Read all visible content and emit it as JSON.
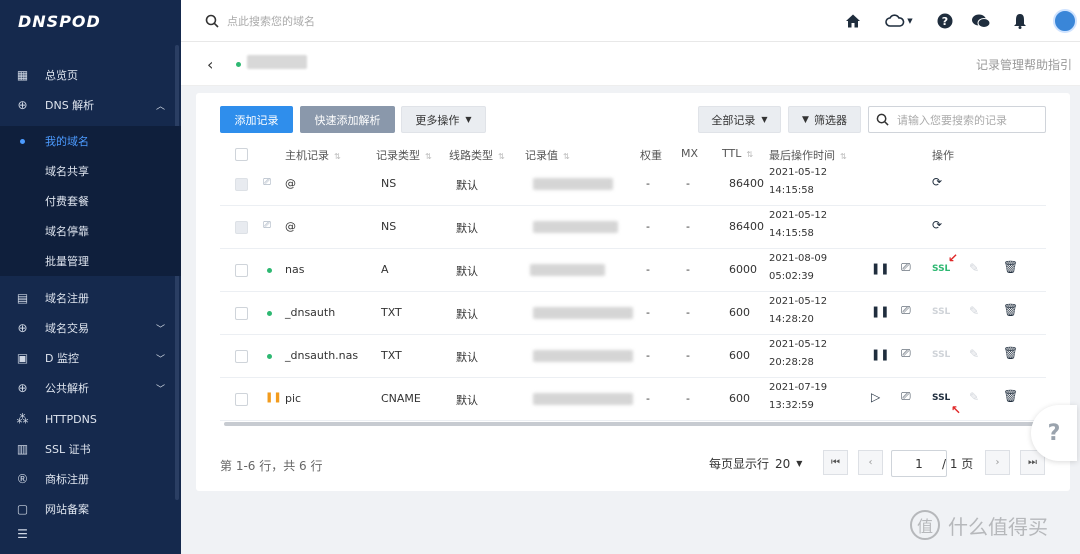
{
  "sidebar": {
    "logo": "DNSPOD",
    "items": [
      {
        "label": "总览页",
        "icon": "grid-icon"
      },
      {
        "label": "DNS 解析",
        "icon": "globe-icon",
        "expanded": true
      },
      {
        "label": "域名注册",
        "icon": "calendar-icon"
      },
      {
        "label": "域名交易",
        "icon": "globe-icon"
      },
      {
        "label": "D 监控",
        "icon": "monitor-icon"
      },
      {
        "label": "公共解析",
        "icon": "globe-icon"
      },
      {
        "label": "HTTPDNS",
        "icon": "network-icon"
      },
      {
        "label": "SSL 证书",
        "icon": "certificate-icon"
      },
      {
        "label": "商标注册",
        "icon": "registered-icon"
      },
      {
        "label": "网站备案",
        "icon": "document-icon"
      }
    ],
    "dns_sub": [
      {
        "label": "我的域名",
        "active": true
      },
      {
        "label": "域名共享"
      },
      {
        "label": "付费套餐"
      },
      {
        "label": "域名停靠"
      },
      {
        "label": "批量管理"
      }
    ]
  },
  "topbar": {
    "search_placeholder": "点此搜索您的域名"
  },
  "subhead": {
    "help_link": "记录管理帮助指引"
  },
  "toolbar": {
    "add_record": "添加记录",
    "quick_add": "快速添加解析",
    "more_ops": "更多操作",
    "all_records": "全部记录",
    "filter": "筛选器",
    "search_placeholder": "请输入您要搜索的记录"
  },
  "table": {
    "headers": {
      "host": "主机记录",
      "type": "记录类型",
      "line": "线路类型",
      "value": "记录值",
      "weight": "权重",
      "mx": "MX",
      "ttl": "TTL",
      "last_op": "最后操作时间",
      "actions": "操作"
    },
    "rows": [
      {
        "host": "@",
        "type": "NS",
        "line": "默认",
        "weight": "-",
        "mx": "-",
        "ttl": "86400",
        "date": "2021-05-12",
        "time": "14:15:58",
        "status": "system"
      },
      {
        "host": "@",
        "type": "NS",
        "line": "默认",
        "weight": "-",
        "mx": "-",
        "ttl": "86400",
        "date": "2021-05-12",
        "time": "14:15:58",
        "status": "system"
      },
      {
        "host": "nas",
        "type": "A",
        "line": "默认",
        "weight": "-",
        "mx": "-",
        "ttl": "6000",
        "date": "2021-08-09",
        "time": "05:02:39",
        "status": "enabled",
        "ssl": "SSL",
        "ssl_color": "#2eb872"
      },
      {
        "host": "_dnsauth",
        "type": "TXT",
        "line": "默认",
        "weight": "-",
        "mx": "-",
        "ttl": "600",
        "date": "2021-05-12",
        "time": "14:28:20",
        "status": "enabled",
        "ssl": "SSL",
        "ssl_color": "#cfd3d8"
      },
      {
        "host": "_dnsauth.nas",
        "type": "TXT",
        "line": "默认",
        "weight": "-",
        "mx": "-",
        "ttl": "600",
        "date": "2021-05-12",
        "time": "20:28:28",
        "status": "enabled",
        "ssl": "SSL",
        "ssl_color": "#cfd3d8"
      },
      {
        "host": "pic",
        "type": "CNAME",
        "line": "默认",
        "weight": "-",
        "mx": "-",
        "ttl": "600",
        "date": "2021-07-19",
        "time": "13:32:59",
        "status": "paused",
        "ssl": "SSL",
        "ssl_color": "#1f2d3d"
      }
    ]
  },
  "pagination": {
    "summary": "第 1-6 行，共 6 行",
    "per_page_label": "每页显示行",
    "per_page_value": "20",
    "current_page": "1",
    "total_pages": "/ 1 页"
  },
  "float_help": "?",
  "watermark": "什么值得买",
  "watermark_mark": "值"
}
